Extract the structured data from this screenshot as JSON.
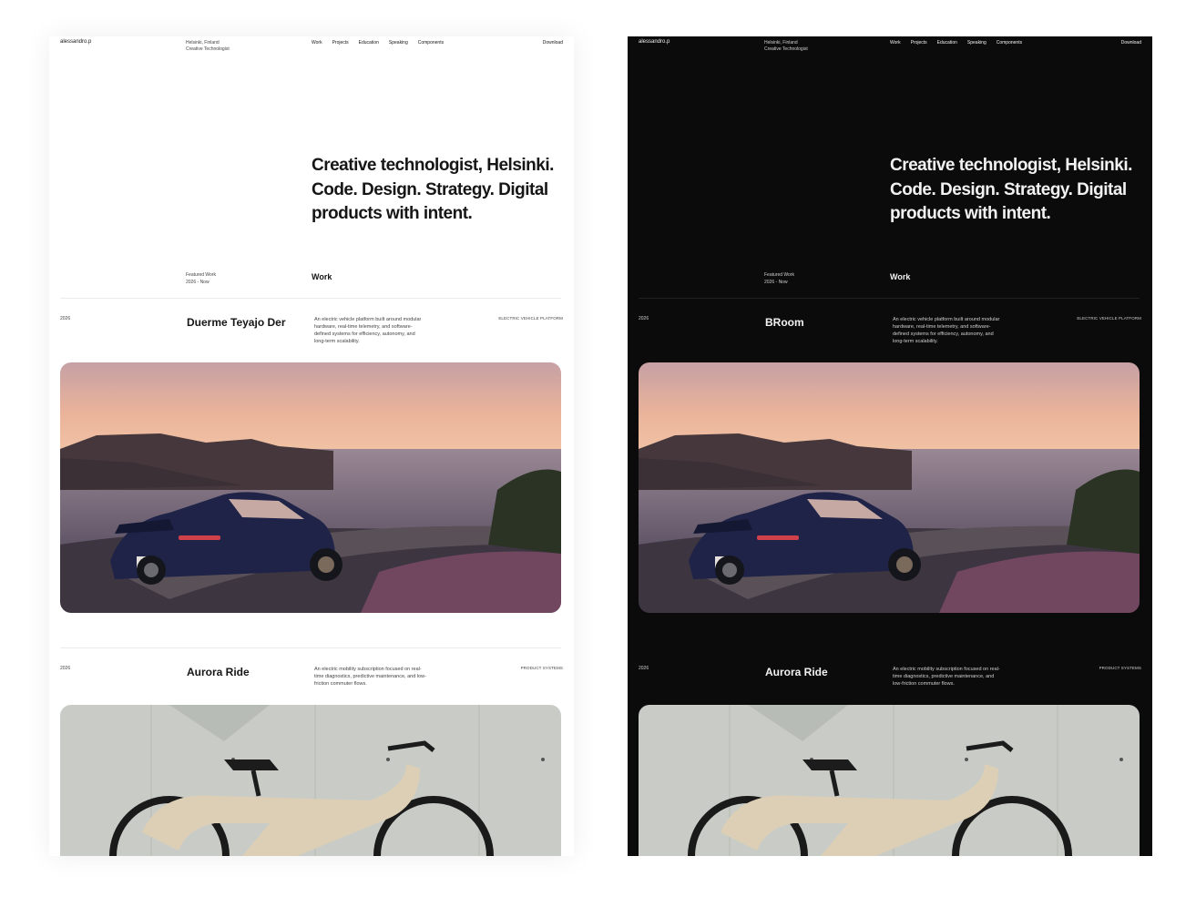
{
  "header": {
    "brand": "alessandro.p",
    "location": "Helsinki, Finland",
    "role": "Creative Technologist",
    "nav": [
      "Work",
      "Projects",
      "Education",
      "Speaking",
      "Components"
    ],
    "download": "Download"
  },
  "hero": {
    "line1": "Creative technologist, Helsinki.",
    "line2": "Code. Design. Strategy. Digital",
    "line3": "products with intent."
  },
  "featured": {
    "label": "Featured Work",
    "range": "2026 - Now",
    "section": "Work"
  },
  "light_projects": [
    {
      "year": "2026",
      "title": "Duerme Teyajo Der",
      "desc_lines": [
        "An electric vehicle platform built around modular",
        "hardware, real-time telemetry, and software-",
        "defined systems for efficiency, autonomy, and",
        "long-term scalability."
      ],
      "tag": "ELECTRIC VEHICLE PLATFORM"
    },
    {
      "year": "2026",
      "title": "Aurora Ride",
      "desc_lines": [
        "An electric mobility subscription focused on real-",
        "time diagnostics, predictive maintenance, and low-",
        "friction commuter flows."
      ],
      "tag": "PRODUCT SYSTEMS"
    }
  ],
  "dark_projects": [
    {
      "year": "2026",
      "title": "BRoom",
      "desc_lines": [
        "An electric vehicle platform built around modular",
        "hardware, real-time telemetry, and software-",
        "defined systems for efficiency, autonomy, and",
        "long-term scalability."
      ],
      "tag": "ELECTRIC VEHICLE PLATFORM"
    },
    {
      "year": "2026",
      "title": "Aurora Ride",
      "desc_lines": [
        "An electric mobility subscription focused on real-",
        "time diagnostics, predictive maintenance, and",
        "low-friction commuter flows."
      ],
      "tag": "PRODUCT SYSTEMS"
    }
  ],
  "colors": {
    "light_bg": "#ffffff",
    "dark_bg": "#0b0b0c",
    "car_body": "#1e2347",
    "bike_frame": "#dccfb5"
  },
  "images": [
    "sports-car-coastal-sunset-image",
    "electric-bike-concrete-wall-image"
  ]
}
